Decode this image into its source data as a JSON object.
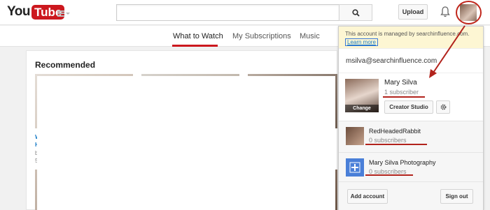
{
  "header": {
    "logo_you": "You",
    "logo_tube": "Tube",
    "search_placeholder": "",
    "upload_label": "Upload"
  },
  "tabs": [
    {
      "label": "What to Watch",
      "active": true
    },
    {
      "label": "My Subscriptions",
      "active": false
    },
    {
      "label": "Music",
      "active": false
    }
  ],
  "main": {
    "section_title": "Recommended",
    "side_snippets": [
      "W",
      "H",
      "b",
      "5"
    ]
  },
  "account_menu": {
    "managed_notice": "This account is managed by searchinfluence.com.",
    "learn_more": "Learn more",
    "email": "msilva@searchinfluence.com",
    "primary": {
      "name": "Mary Silva",
      "subscribers": "1 subscriber",
      "photo_overlay": "Change",
      "creator_studio": "Creator Studio"
    },
    "channels": [
      {
        "name": "RedHeadedRabbit",
        "subscribers": "0 subscribers"
      },
      {
        "name": "Mary Silva Photography",
        "subscribers": "0 subscribers"
      }
    ],
    "add_account": "Add account",
    "sign_out": "Sign out"
  },
  "colors": {
    "brand_red": "#cc181e",
    "annotation_red": "#b2231c",
    "link_blue": "#167ac6",
    "notice_bg": "#fdf6d3"
  }
}
